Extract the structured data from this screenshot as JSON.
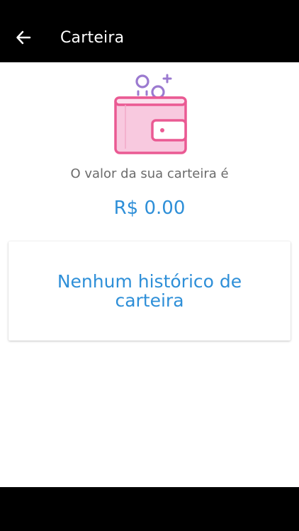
{
  "header": {
    "title": "Carteira",
    "back_icon": "arrow-left-icon"
  },
  "wallet": {
    "icon": "wallet-icon",
    "caption": "O valor da sua carteira é",
    "amount": "R$ 0.00"
  },
  "history": {
    "empty_text": "Nenhum histórico de carteira"
  },
  "colors": {
    "app_bar": "#000000",
    "accent_blue": "#2e8fd8",
    "wallet_pink": "#ea5a93",
    "wallet_fill": "#f8c9df",
    "coin_purple": "#9b7ad0"
  }
}
